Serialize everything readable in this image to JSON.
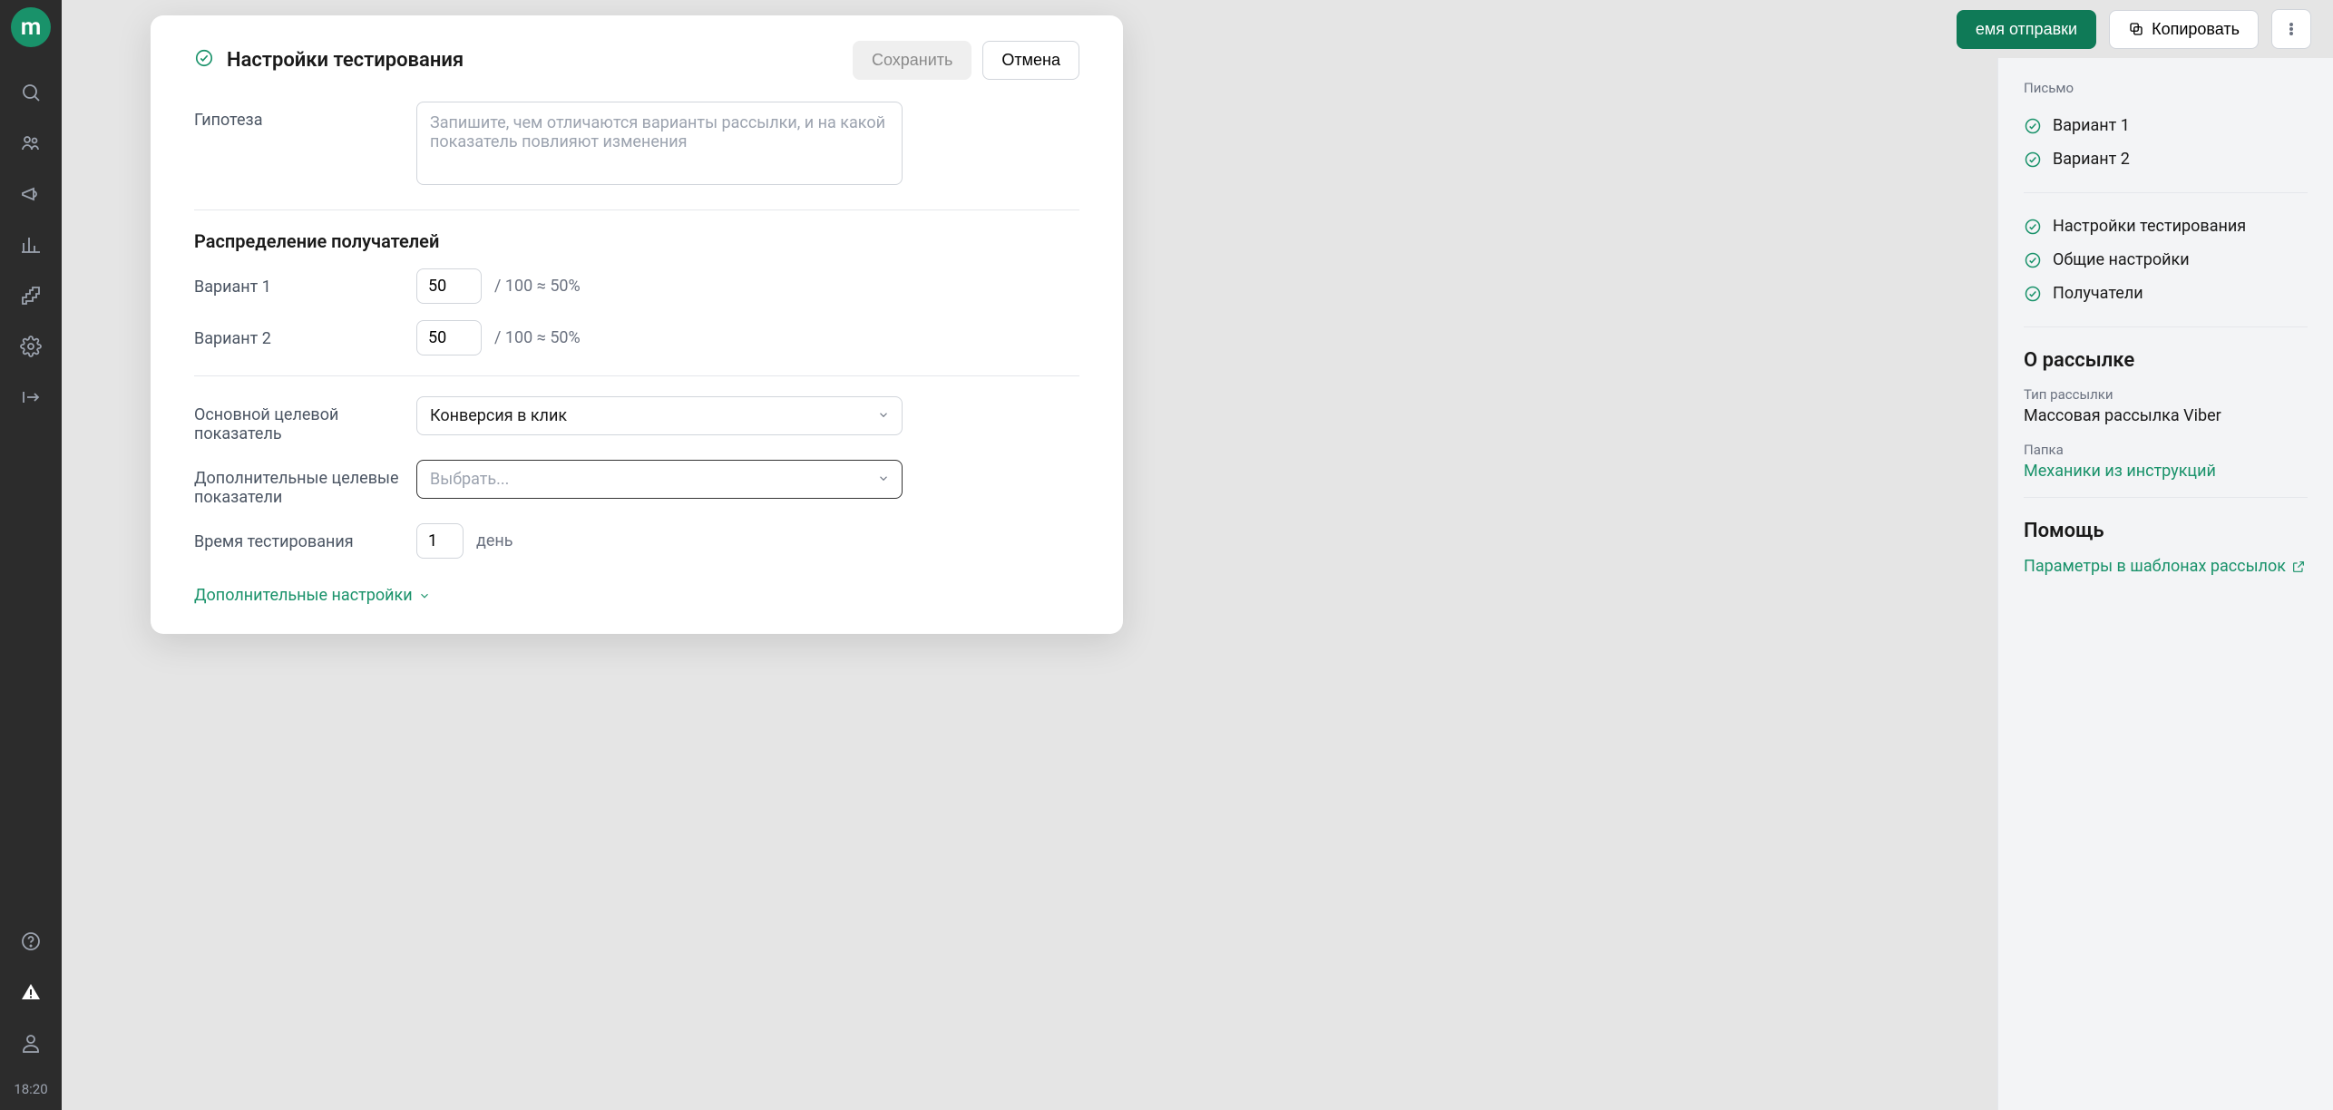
{
  "rail": {
    "logo_letter": "m",
    "time": "18:20"
  },
  "topbar": {
    "send_time_label": "емя отправки",
    "copy_label": "Копировать"
  },
  "modal": {
    "title": "Настройки тестирования",
    "save_label": "Сохранить",
    "cancel_label": "Отмена",
    "hypothesis_label": "Гипотеза",
    "hypothesis_placeholder": "Запишите, чем отличаются варианты рассылки, и на какой показатель повлияют изменения",
    "distribution_title": "Распределение получателей",
    "variant1_label": "Вариант 1",
    "variant1_value": "50",
    "variant1_hint": "/ 100 ≈ 50%",
    "variant2_label": "Вариант 2",
    "variant2_value": "50",
    "variant2_hint": "/ 100 ≈ 50%",
    "primary_metric_label": "Основной целевой показатель",
    "primary_metric_value": "Конверсия в клик",
    "additional_metrics_label": "Дополнительные целевые показатели",
    "additional_metrics_placeholder": "Выбрать...",
    "test_time_label": "Время тестирования",
    "test_time_value": "1",
    "test_time_unit": "день",
    "advanced_toggle": "Дополнительные настройки"
  },
  "right": {
    "letter_heading": "Письмо",
    "items_letter": [
      "Вариант 1",
      "Вариант 2"
    ],
    "items_section": [
      "Настройки тестирования",
      "Общие настройки",
      "Получатели"
    ],
    "about_title": "О рассылке",
    "type_label": "Тип рассылки",
    "type_value": "Массовая рассылка Viber",
    "folder_label": "Папка",
    "folder_link": "Механики из инструкций",
    "help_title": "Помощь",
    "help_link": "Параметры в шаблонах рассылок"
  }
}
